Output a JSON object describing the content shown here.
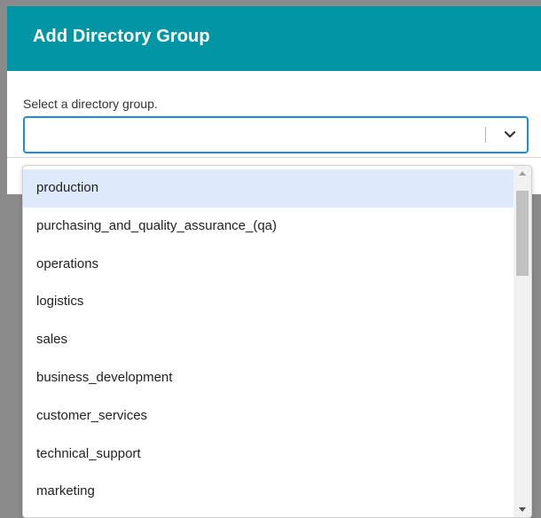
{
  "modal": {
    "title": "Add Directory Group",
    "field_label": "Select a directory group.",
    "select_value": ""
  },
  "dropdown": {
    "options": [
      "production",
      "purchasing_and_quality_assurance_(qa)",
      "operations",
      "logistics",
      "sales",
      "business_development",
      "customer_services",
      "technical_support",
      "marketing"
    ],
    "highlighted_option": "production"
  },
  "colors": {
    "header": "#0296a4",
    "focus_border": "#1d8fd6",
    "highlight": "#ddeafb",
    "overlay": "#8a8a8a"
  },
  "icons": {
    "select": "chevron-down-icon",
    "scroll_up": "triangle-up-icon",
    "scroll_down": "triangle-down-icon"
  }
}
